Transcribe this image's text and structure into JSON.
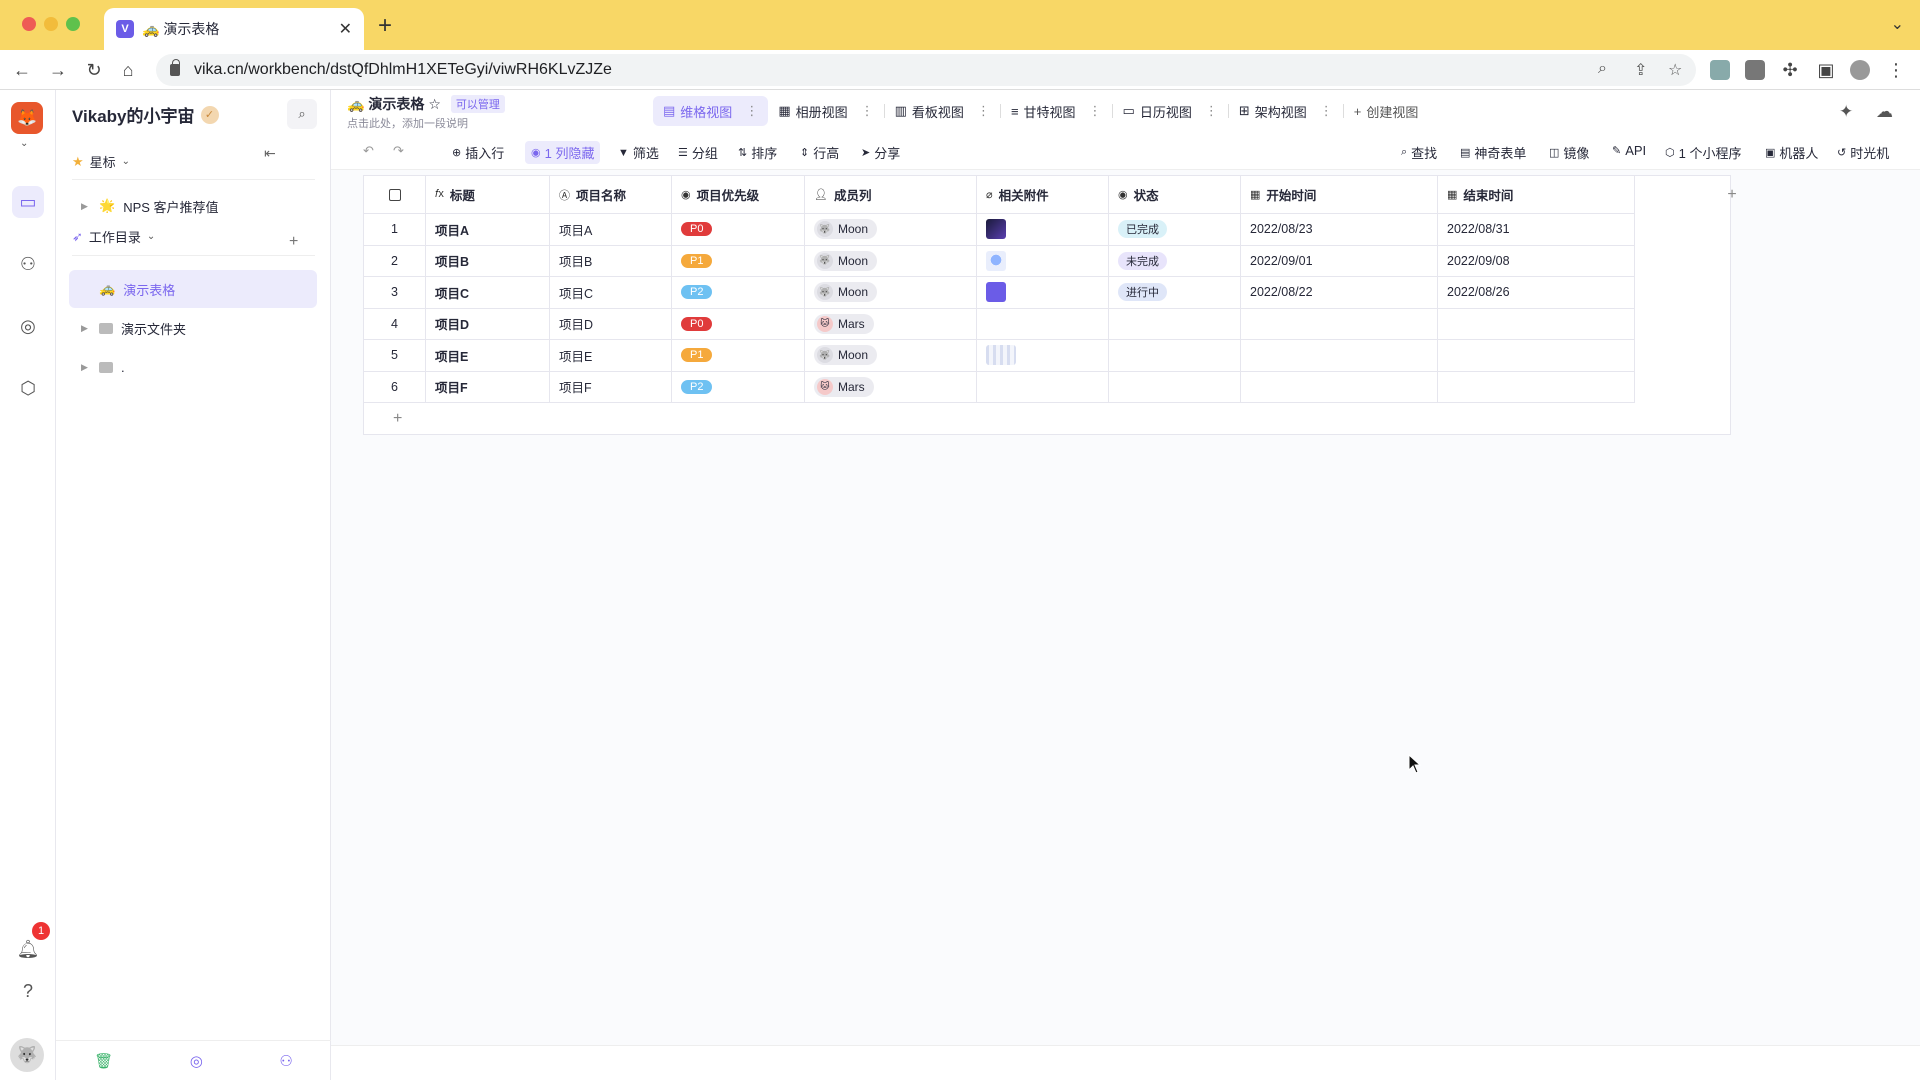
{
  "browser": {
    "tab_title": "🚕 演示表格",
    "tab_favicon": "V",
    "url": "vika.cn/workbench/dstQfDhlmH1XETeGyi/viwRH6KLvZJZe",
    "icons": [
      "back-icon",
      "forward-icon",
      "reload-icon",
      "home-icon",
      "zoom-icon",
      "share-icon",
      "star-icon",
      "extensions-icon",
      "sidepanel-icon",
      "profile-icon",
      "kebab-menu-icon"
    ]
  },
  "rail": {
    "notification_count": "1",
    "icons": [
      "workbench-icon",
      "members-icon",
      "planet-icon",
      "settings-icon",
      "bell-icon",
      "help-icon"
    ]
  },
  "sidebar": {
    "space_name": "Vikaby的小宇宙",
    "starred_label": "星标",
    "starred_items": [
      {
        "emoji": "🌟",
        "label": "NPS 客户推荐值"
      }
    ],
    "catalog_label": "工作目录",
    "catalog_items": [
      {
        "emoji": "🚕",
        "label": "演示表格",
        "active": true
      },
      {
        "label": "演示文件夹"
      },
      {
        "label": "."
      }
    ]
  },
  "header": {
    "datasheet_title": "🚕 演示表格",
    "permission_tag": "可以管理",
    "description": "点击此处，添加一段说明",
    "views": [
      {
        "icon": "▤",
        "label": "维格视图",
        "active": true
      },
      {
        "icon": "▦",
        "label": "相册视图"
      },
      {
        "icon": "▥",
        "label": "看板视图"
      },
      {
        "icon": "≡",
        "label": "甘特视图"
      },
      {
        "icon": "▭",
        "label": "日历视图"
      },
      {
        "icon": "⊞",
        "label": "架构视图"
      }
    ],
    "create_view_label": "创建视图"
  },
  "toolbar": {
    "insert_row": "插入行",
    "hidden_cols": "1 列隐藏",
    "filter": "筛选",
    "group": "分组",
    "sort": "排序",
    "row_height": "行高",
    "share": "分享",
    "find": "查找",
    "magic_form": "神奇表单",
    "mirror": "镜像",
    "api": "API",
    "widgets": "1 个小程序",
    "robot": "机器人",
    "time_machine": "时光机"
  },
  "grid": {
    "columns": [
      "标题",
      "项目名称",
      "项目优先级",
      "成员列",
      "相关附件",
      "状态",
      "开始时间",
      "结束时间"
    ],
    "rows": [
      {
        "idx": "1",
        "title": "项目A",
        "name": "项目A",
        "priority": "P0",
        "member": "Moon",
        "attachment": "dark-image",
        "status": "已完成",
        "start": "2022/08/23",
        "end": "2022/08/31"
      },
      {
        "idx": "2",
        "title": "项目B",
        "name": "项目B",
        "priority": "P1",
        "member": "Moon",
        "attachment": "astronaut-image",
        "status": "未完成",
        "start": "2022/09/01",
        "end": "2022/09/08"
      },
      {
        "idx": "3",
        "title": "项目C",
        "name": "项目C",
        "priority": "P2",
        "member": "Moon",
        "attachment": "logo-image",
        "status": "进行中",
        "start": "2022/08/22",
        "end": "2022/08/26"
      },
      {
        "idx": "4",
        "title": "项目D",
        "name": "项目D",
        "priority": "P0",
        "member": "Mars",
        "attachment": "",
        "status": "",
        "start": "",
        "end": ""
      },
      {
        "idx": "5",
        "title": "项目E",
        "name": "项目E",
        "priority": "P1",
        "member": "Moon",
        "attachment": "diagram-image",
        "status": "",
        "start": "",
        "end": ""
      },
      {
        "idx": "6",
        "title": "项目F",
        "name": "项目F",
        "priority": "P2",
        "member": "Mars",
        "attachment": "",
        "status": "",
        "start": "",
        "end": ""
      }
    ]
  },
  "colors": {
    "accent": "#7b67ee",
    "p0": "#e03b3b",
    "p1": "#f5a93c",
    "p2": "#6ec1f2",
    "status_done_bg": "#d9f1f8",
    "status_todo_bg": "#e8e4fb",
    "status_doing_bg": "#dfe6f8"
  }
}
